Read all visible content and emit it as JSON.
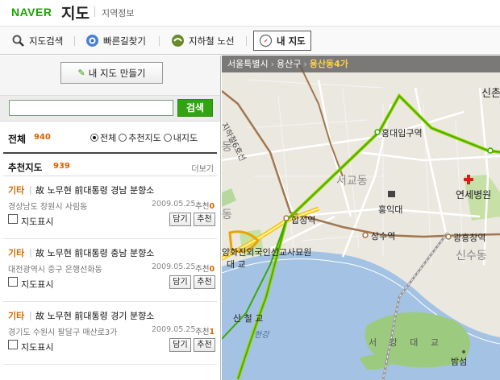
{
  "header": {
    "logo": "NAVER",
    "service": "지도",
    "subtitle": "지역정보"
  },
  "toolbar": {
    "items": [
      {
        "label": "지도검색",
        "icon": "magnifier-icon"
      },
      {
        "label": "빠른길찾기",
        "icon": "route-icon"
      },
      {
        "label": "지하철 노선",
        "icon": "subway-icon"
      },
      {
        "label": "내 지도",
        "icon": "compass-icon",
        "active": true
      }
    ]
  },
  "left": {
    "make_button": "내 지도 만들기",
    "search": {
      "value": "",
      "button": "검색"
    },
    "filter": {
      "title": "전체",
      "count": "940",
      "options": [
        {
          "label": "전체",
          "selected": true
        },
        {
          "label": "추천지도",
          "selected": false
        },
        {
          "label": "내지도",
          "selected": false
        }
      ]
    },
    "recommended": {
      "title": "추천지도",
      "count": "939",
      "more": "더보기"
    },
    "items": [
      {
        "category": "기타",
        "title": "故 노무현 前대통령 경남 분향소",
        "address": "경상남도 창원시 사림동",
        "date": "2009.05.25",
        "rec_label": "추천",
        "rec_count": "0",
        "check_label": "지도표시",
        "btn1": "담기",
        "btn2": "추천"
      },
      {
        "category": "기타",
        "title": "故 노무현 前대통령 충남 분향소",
        "address": "대전광역시 중구 은행선화동",
        "date": "2009.05.25",
        "rec_label": "추천",
        "rec_count": "0",
        "check_label": "지도표시",
        "btn1": "담기",
        "btn2": "추천"
      },
      {
        "category": "기타",
        "title": "故 노무현 前대통령 경기 분향소",
        "address": "경기도 수원시 팔달구 매산로3가",
        "date": "2009.05.25",
        "rec_label": "추천",
        "rec_count": "1",
        "check_label": "지도표시",
        "btn1": "담기",
        "btn2": "추천"
      }
    ]
  },
  "map": {
    "breadcrumb": [
      "서울특별시",
      "용산구",
      "용산동4가"
    ],
    "labels": {
      "sinchon": "신촌",
      "hongdae_station": "홍대입구역",
      "seogyo": "서교동",
      "yonsei": "연세병원",
      "hongik": "홍익대",
      "hapjeong": "합정역",
      "sangsu": "상수역",
      "gwangheungchang": "광흥창역",
      "sinsu": "신수동",
      "cemetery": "양화진외국인선교사묘원",
      "hangang": "한강",
      "seogang_bridge": "서 강 대 교",
      "bamseom": "밤섬",
      "yanghwa_bridge_a": "대 교",
      "yanghwa_bridge_b": "산 철 교",
      "dong_left": "동",
      "dong_left2": "동",
      "road_label": "지하철6호선"
    }
  }
}
